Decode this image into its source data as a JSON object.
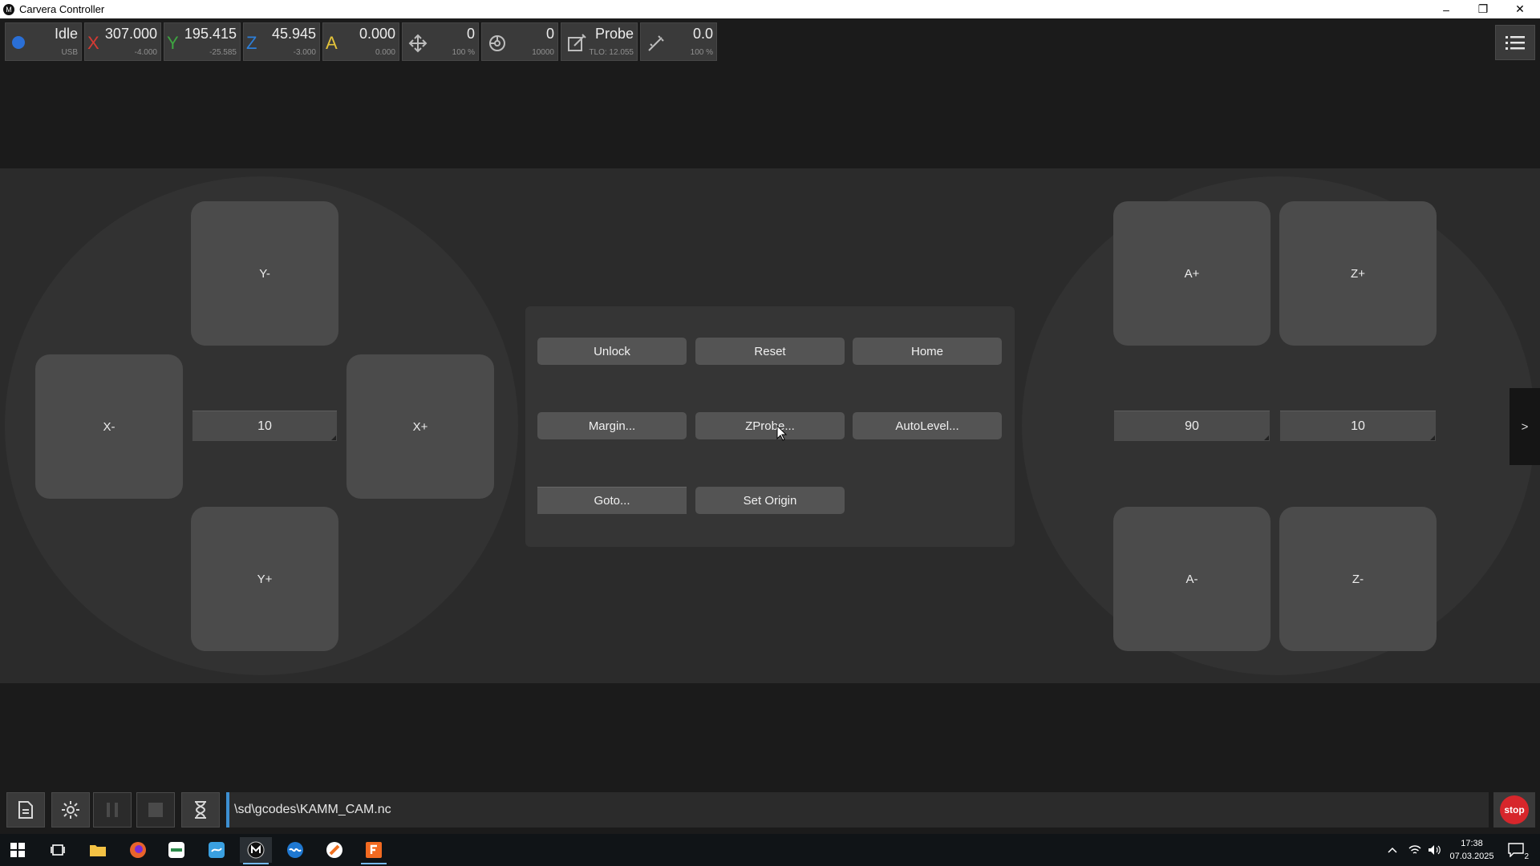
{
  "window": {
    "title": "Carvera Controller",
    "app_icon_glyph": "M",
    "minimize": "–",
    "restore": "❐",
    "close": "✕"
  },
  "status": {
    "state": {
      "label": "Idle",
      "sub": "USB",
      "dot_color": "#2a6fd6"
    },
    "x": {
      "letter": "X",
      "value": "307.000",
      "sub": "-4.000",
      "color": "#d53a33"
    },
    "y": {
      "letter": "Y",
      "value": "195.415",
      "sub": "-25.585",
      "color": "#3ea541"
    },
    "z": {
      "letter": "Z",
      "value": "45.945",
      "sub": "-3.000",
      "color": "#2d7fd8"
    },
    "a": {
      "letter": "A",
      "value": "0.000",
      "sub": "0.000",
      "color": "#e2c23a"
    },
    "feed": {
      "value": "0",
      "sub": "100 %",
      "icon": "feed-move-icon"
    },
    "spindle": {
      "value": "0",
      "sub": "10000",
      "icon": "spindle-icon"
    },
    "tool": {
      "value": "Probe",
      "sub": "TLO: 12.055",
      "icon": "tool-icon"
    },
    "laser": {
      "value": "0.0",
      "sub": "100 %",
      "icon": "laser-icon"
    }
  },
  "jog_left": {
    "y_minus": "Y-",
    "y_plus": "Y+",
    "x_minus": "X-",
    "x_plus": "X+",
    "step": "10"
  },
  "jog_right": {
    "a_plus": "A+",
    "a_minus": "A-",
    "z_plus": "Z+",
    "z_minus": "Z-",
    "a_step": "90",
    "z_step": "10"
  },
  "center": {
    "unlock": "Unlock",
    "reset": "Reset",
    "home": "Home",
    "margin": "Margin...",
    "zprobe": "ZProbe...",
    "autolevel": "AutoLevel...",
    "goto": "Goto...",
    "set_origin": "Set Origin"
  },
  "side_tab": ">",
  "bottom": {
    "file_path": "\\sd\\gcodes\\KAMM_CAM.nc",
    "stop_label": "stop"
  },
  "taskbar": {
    "time": "17:38",
    "date": "07.03.2025",
    "notifications": "2"
  },
  "colors": {
    "accent": "#3d8fd1",
    "stop": "#d7262b",
    "button": "#545454",
    "jog": "#4b4b4b"
  }
}
